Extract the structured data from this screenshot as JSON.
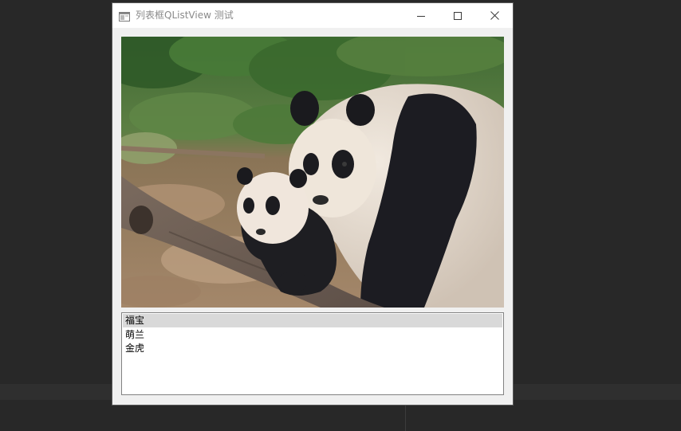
{
  "window": {
    "title": "列表框QListView 测试"
  },
  "titlebar_buttons": {
    "minimize": "minimize-icon",
    "maximize": "maximize-icon",
    "close": "close-icon"
  },
  "image": {
    "subject": "giant-panda-mother-and-cub-photo"
  },
  "list": {
    "items": [
      "福宝",
      "萌兰",
      "金虎"
    ],
    "selected_index": 0
  },
  "colors": {
    "selection": "#d9d9d9",
    "window_bg": "#f0f0f0",
    "desktop_bg": "#282828"
  }
}
